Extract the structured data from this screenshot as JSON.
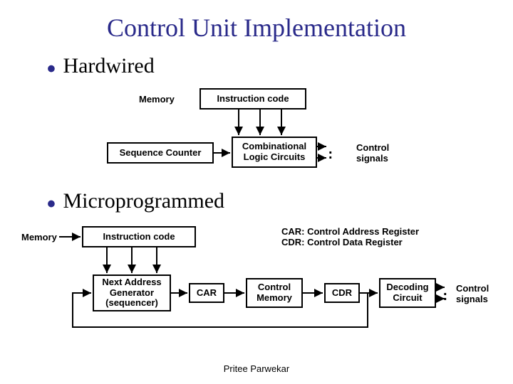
{
  "title": "Control Unit Implementation",
  "sections": {
    "hardwired": "Hardwired",
    "microprogrammed": "Microprogrammed"
  },
  "hardwired": {
    "memory": "Memory",
    "instruction_code": "Instruction code",
    "sequence_counter": "Sequence Counter",
    "combinational": "Combinational\nLogic Circuits",
    "control_signals": "Control\nsignals"
  },
  "micro": {
    "memory": "Memory",
    "instruction_code": "Instruction code",
    "legend": "CAR: Control Address Register\nCDR: Control Data Register",
    "next_addr": "Next Address\nGenerator\n(sequencer)",
    "car": "CAR",
    "control_memory": "Control\nMemory",
    "cdr": "CDR",
    "decoding": "Decoding\nCircuit",
    "control_signals": "Control\nsignals"
  },
  "footer": "Pritee Parwekar"
}
